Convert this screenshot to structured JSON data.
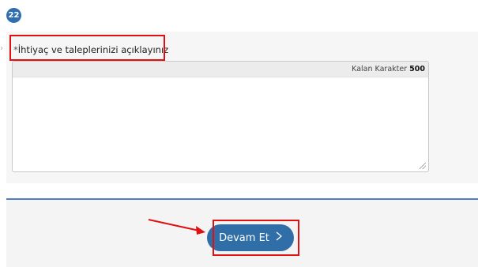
{
  "step": {
    "number": "22"
  },
  "question": {
    "required_marker": "*",
    "label": "İhtiyaç ve taleplerinizi açıklayınız"
  },
  "textarea": {
    "remaining_label": "Kalan Karakter",
    "remaining_count": "500",
    "value": ""
  },
  "actions": {
    "continue_label": "Devam Et",
    "continue_icon": "chevron-right-icon"
  },
  "colors": {
    "accent": "#2f6ea6",
    "highlight": "#e01010"
  }
}
